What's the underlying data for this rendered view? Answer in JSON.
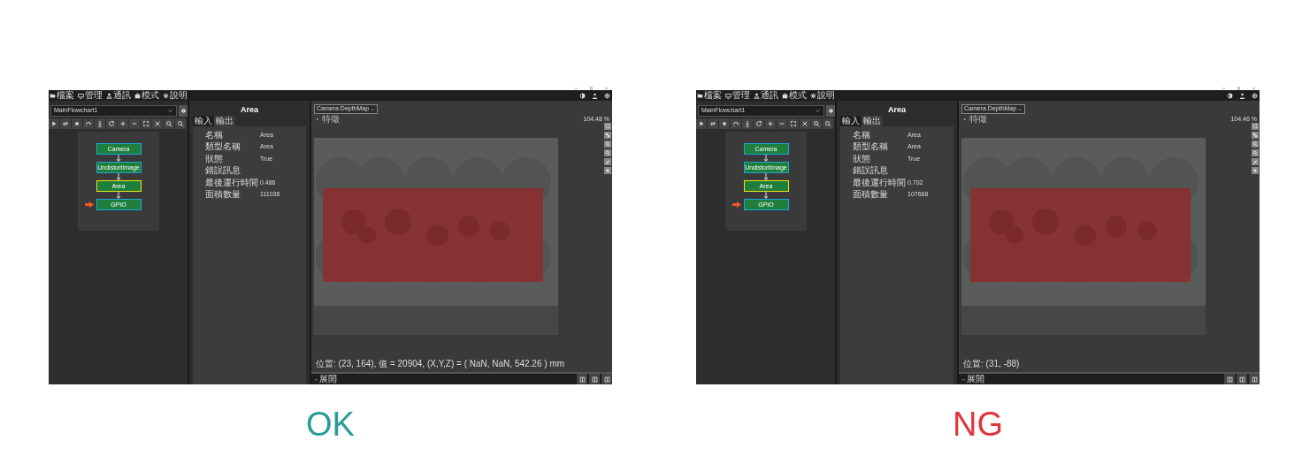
{
  "panels": [
    {
      "menu": [
        {
          "label": "檔案"
        },
        {
          "label": "管理"
        },
        {
          "label": "通訊"
        },
        {
          "label": "模式"
        },
        {
          "label": "說明"
        }
      ],
      "flowchart_selector": "MainFlowchart1",
      "nodes": [
        {
          "label": "Camera",
          "selected": false,
          "current": false
        },
        {
          "label": "UndistortImage",
          "selected": false,
          "current": false
        },
        {
          "label": "Area",
          "selected": true,
          "current": false
        },
        {
          "label": "GPIO",
          "selected": false,
          "current": true
        }
      ],
      "inspector": {
        "title": "Area",
        "tabs": [
          {
            "label": "輸入",
            "selected": false
          },
          {
            "label": "輸出",
            "selected": true
          }
        ],
        "properties": [
          {
            "label": "名稱",
            "value": "Area"
          },
          {
            "label": "類型名稱",
            "value": "Area"
          },
          {
            "label": "狀態",
            "value": "True"
          },
          {
            "label": "錯誤訊息"
          },
          {
            "label": "最後運行時間",
            "value": "0.486"
          },
          {
            "label": "面積數量",
            "value": "111036"
          }
        ]
      },
      "viewer": {
        "source": "Camera DepthMap",
        "feature_toggle": "特徵",
        "zoom": "104.48 %",
        "status": "位置: (23, 164), 值 = 20904, (X,Y,Z) = ( NaN, NaN, 542.26 ) mm",
        "expand_button": "展開"
      },
      "verdict": {
        "text": "OK",
        "color": "#2a9d9a"
      }
    },
    {
      "menu": [
        {
          "label": "檔案"
        },
        {
          "label": "管理"
        },
        {
          "label": "通訊"
        },
        {
          "label": "模式"
        },
        {
          "label": "說明"
        }
      ],
      "flowchart_selector": "MainFlowchart1",
      "nodes": [
        {
          "label": "Camera",
          "selected": false,
          "current": false
        },
        {
          "label": "UndistortImage",
          "selected": false,
          "current": false
        },
        {
          "label": "Area",
          "selected": true,
          "current": false
        },
        {
          "label": "GPIO",
          "selected": false,
          "current": true
        }
      ],
      "inspector": {
        "title": "Area",
        "tabs": [
          {
            "label": "輸入",
            "selected": false
          },
          {
            "label": "輸出",
            "selected": true
          }
        ],
        "properties": [
          {
            "label": "名稱",
            "value": "Area"
          },
          {
            "label": "類型名稱",
            "value": "Area"
          },
          {
            "label": "狀態",
            "value": "True"
          },
          {
            "label": "錯誤訊息"
          },
          {
            "label": "最後運行時間",
            "value": "0.702"
          },
          {
            "label": "面積數量",
            "value": "107668"
          }
        ]
      },
      "viewer": {
        "source": "Camera DepthMap",
        "feature_toggle": "特徵",
        "zoom": "104.46 %",
        "status": "位置: (31, -88)",
        "expand_button": "展開"
      },
      "verdict": {
        "text": "NG",
        "color": "#e0353a"
      }
    }
  ]
}
